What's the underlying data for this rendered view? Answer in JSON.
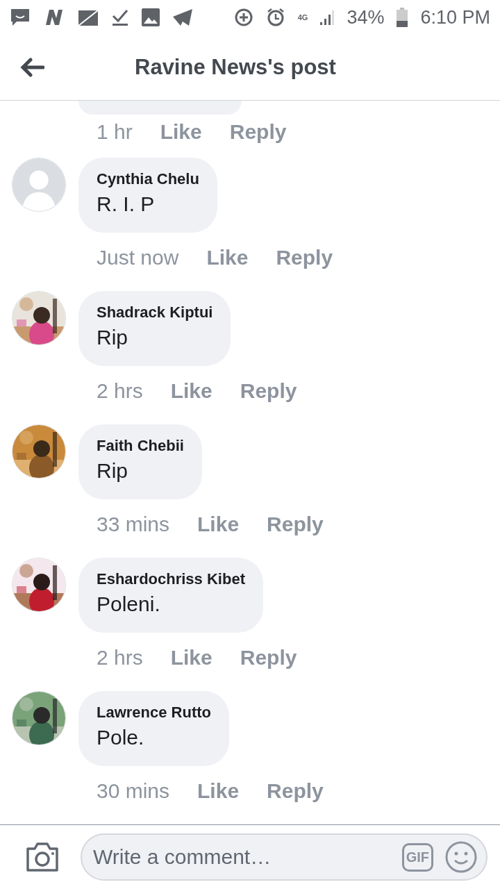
{
  "status_bar": {
    "network": "4G",
    "battery": "34%",
    "time": "6:10 PM"
  },
  "header": {
    "title": "Ravine News's post"
  },
  "clipped_comment": {
    "time": "1 hr",
    "like": "Like",
    "reply": "Reply"
  },
  "comments": [
    {
      "avatar": {
        "kind": "default"
      },
      "author": "Cynthia Chelu",
      "text": "R. I. P",
      "time": "Just now",
      "like": "Like",
      "reply": "Reply"
    },
    {
      "author": "Shadrack Kiptui",
      "text": "Rip",
      "time": "2 hrs",
      "like": "Like",
      "reply": "Reply"
    },
    {
      "author": "Faith Chebii",
      "text": "Rip",
      "time": "33 mins",
      "like": "Like",
      "reply": "Reply"
    },
    {
      "author": "Eshardochriss Kibet",
      "text": "Poleni.",
      "time": "2 hrs",
      "like": "Like",
      "reply": "Reply"
    },
    {
      "author": "Lawrence Rutto",
      "text": "Pole.",
      "time": "30 mins",
      "like": "Like",
      "reply": "Reply"
    }
  ],
  "composer": {
    "placeholder": "Write a comment…",
    "gif": "GIF"
  }
}
